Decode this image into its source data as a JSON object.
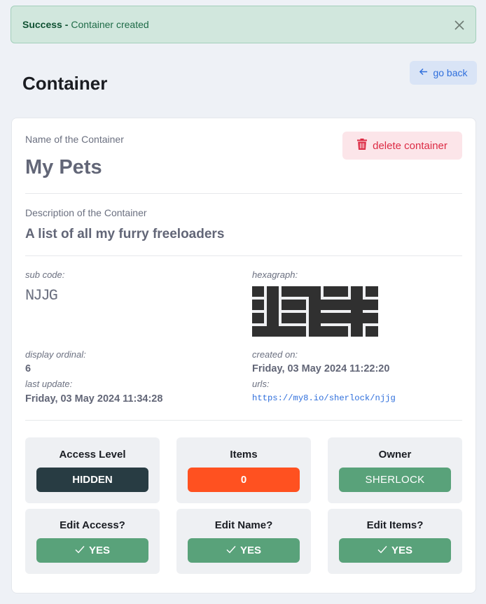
{
  "alert": {
    "title": "Success -",
    "message": "Container created",
    "close_icon": "close-icon"
  },
  "page": {
    "title": "Container",
    "back_label": "go back",
    "back_icon": "arrow-left-icon"
  },
  "container": {
    "name_label": "Name of the Container",
    "name": "My Pets",
    "delete_label": "delete container",
    "delete_icon": "trash-icon",
    "description_label": "Description of the Container",
    "description": "A list of all my furry freeloaders",
    "details": {
      "sub_code_label": "sub code:",
      "sub_code": "NJJG",
      "hexagraph_label": "hexagraph:",
      "display_ordinal_label": "display ordinal:",
      "display_ordinal": "6",
      "last_update_label": "last update:",
      "last_update": "Friday, 03 May 2024 11:34:28",
      "created_on_label": "created on:",
      "created_on": "Friday, 03 May 2024 11:22:20",
      "urls_label": "urls:",
      "url": "https://my8.io/sherlock/njjg"
    },
    "stats": [
      {
        "title": "Access Level",
        "value": "HIDDEN"
      },
      {
        "title": "Items",
        "value": "0"
      },
      {
        "title": "Owner",
        "value": "SHERLOCK"
      },
      {
        "title": "Edit Access?",
        "value": "YES",
        "icon": "check-icon"
      },
      {
        "title": "Edit Name?",
        "value": "YES",
        "icon": "check-icon"
      },
      {
        "title": "Edit Items?",
        "value": "YES",
        "icon": "check-icon"
      }
    ]
  },
  "colors": {
    "page-bg": "#eef1f6",
    "alert-bg": "#d1e7dd",
    "danger-text": "#dc2b44",
    "back-text": "#2f6fdc",
    "badge-dark": "#283c43",
    "badge-orange": "#ff5120",
    "badge-green": "#59a27a"
  }
}
